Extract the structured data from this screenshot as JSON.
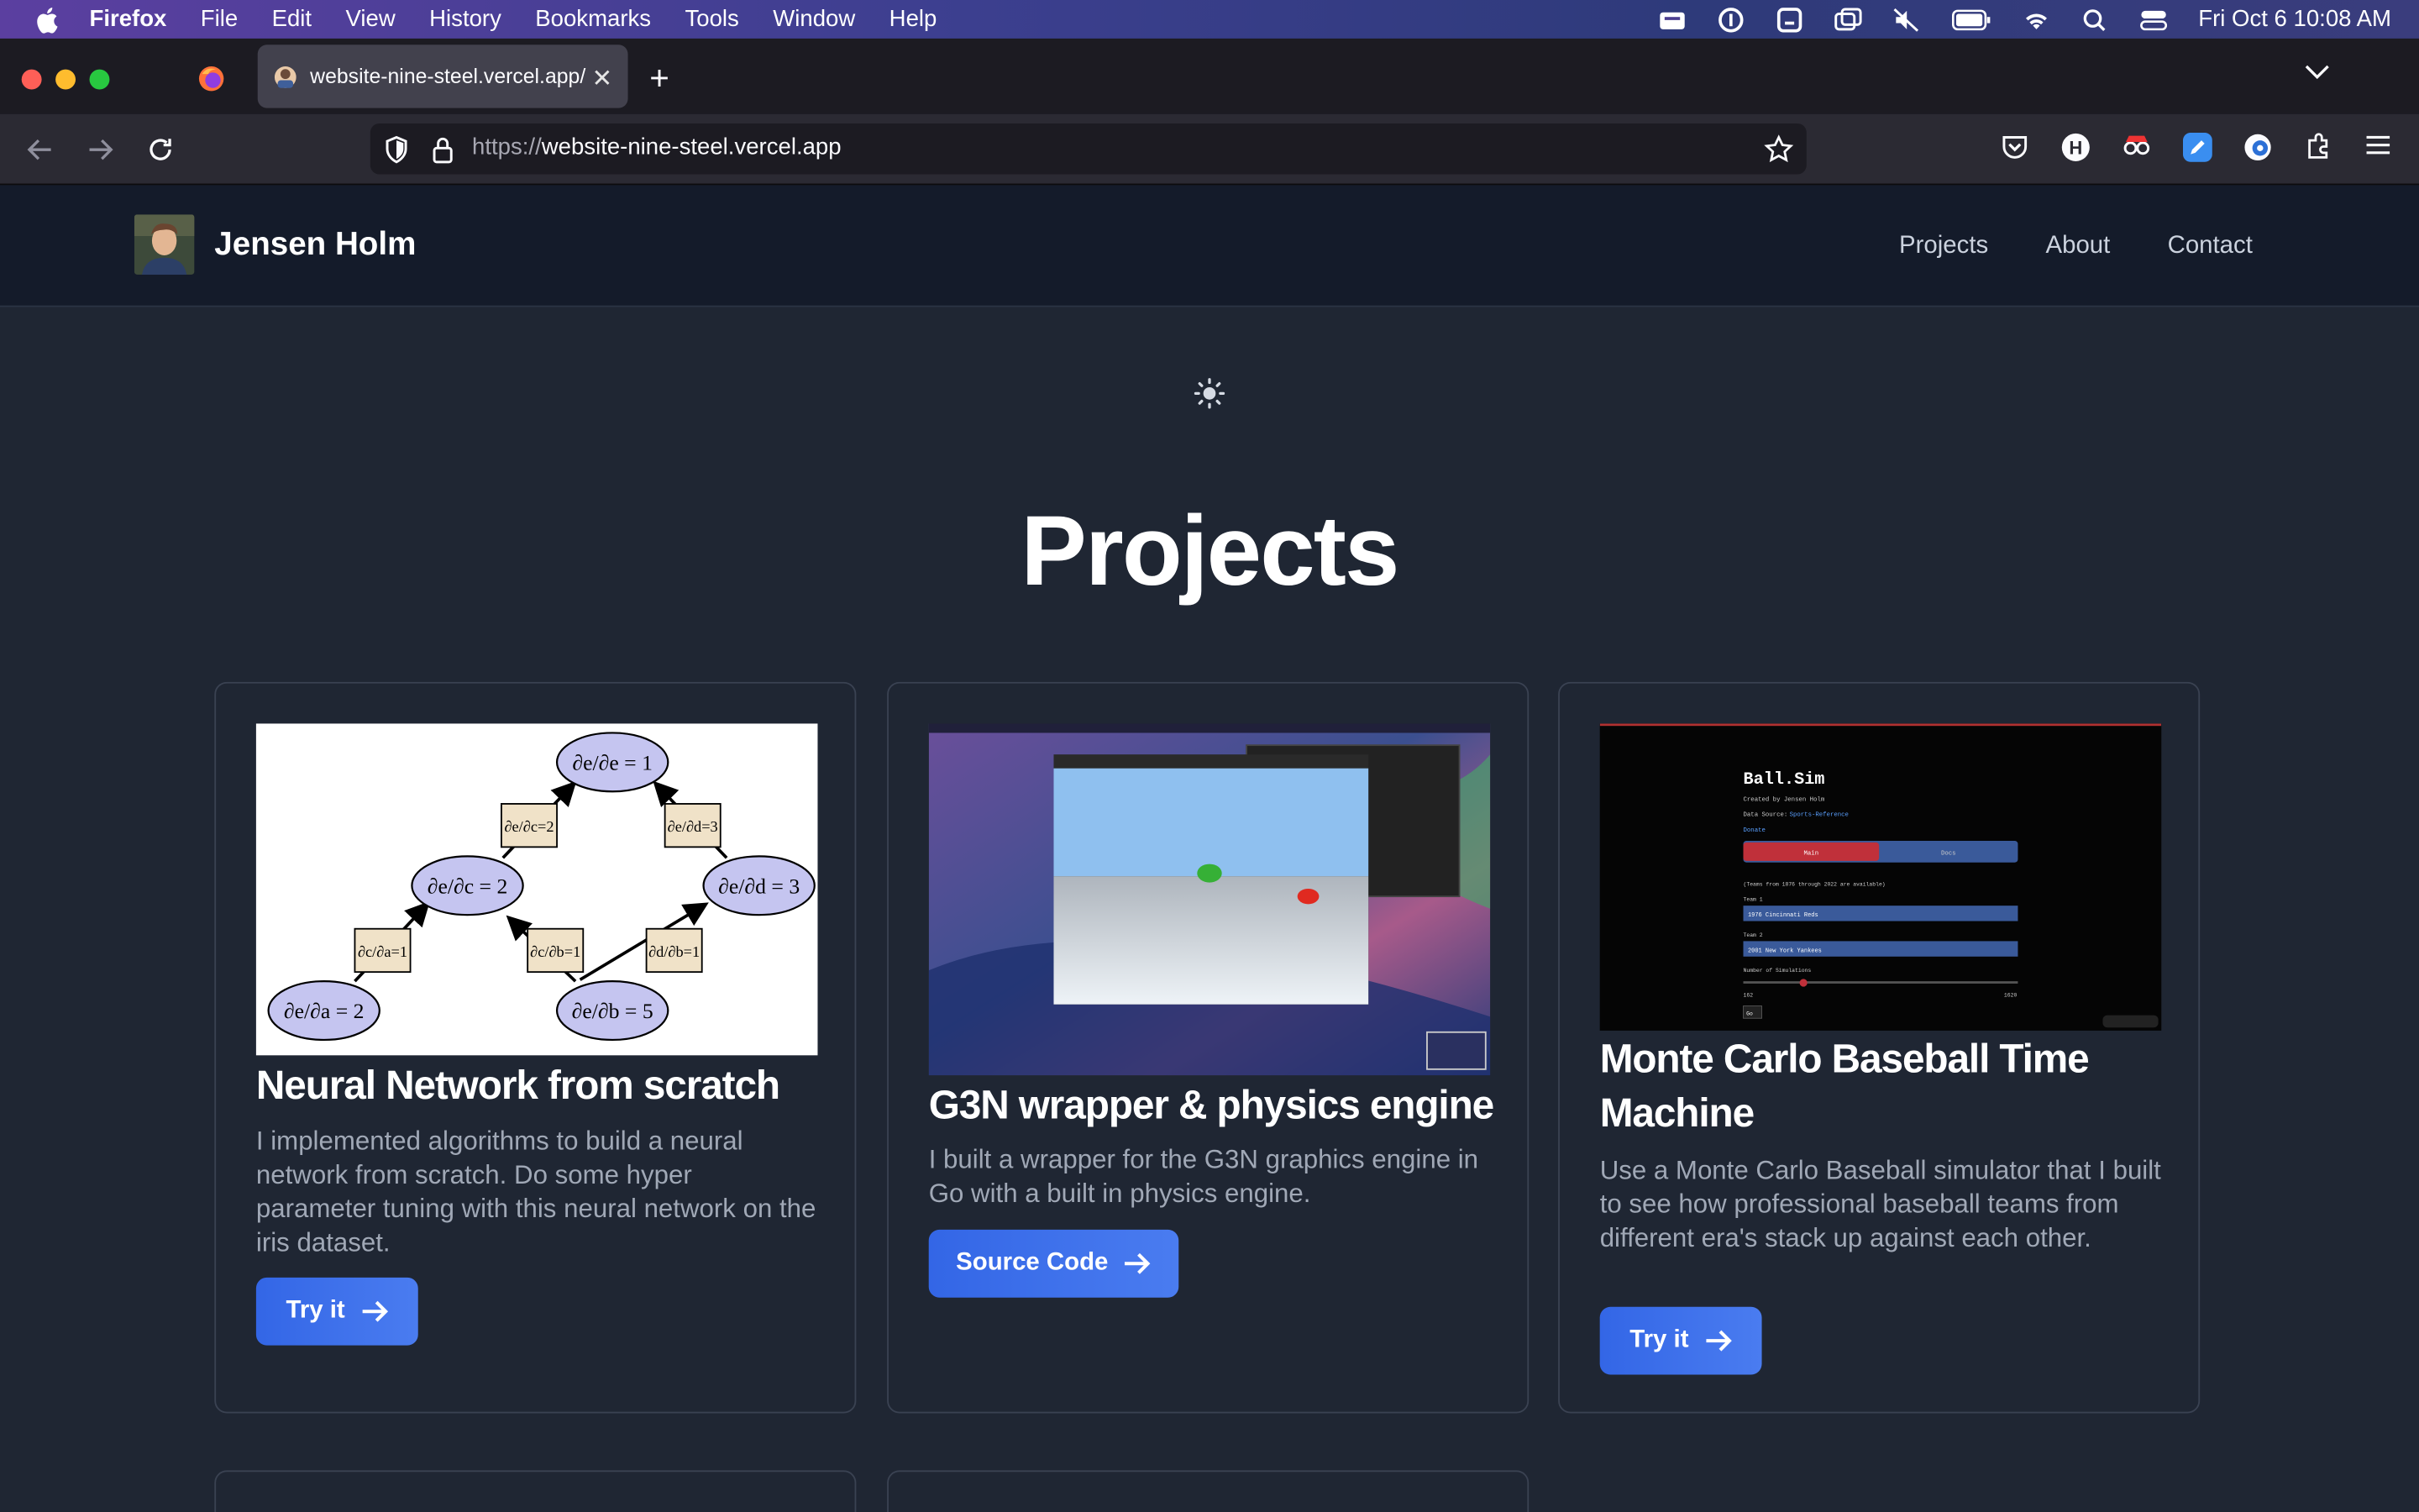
{
  "menubar": {
    "app": "Firefox",
    "menus": [
      "File",
      "Edit",
      "View",
      "History",
      "Bookmarks",
      "Tools",
      "Window",
      "Help"
    ],
    "clock": "Fri Oct 6  10:08 AM"
  },
  "browser": {
    "tab_title": "website-nine-steel.vercel.app/",
    "url_protocol": "https://",
    "url_host": "website-nine-steel.vercel.app"
  },
  "site": {
    "brand": "Jensen Holm",
    "nav": [
      "Projects",
      "About",
      "Contact"
    ],
    "page_title": "Projects"
  },
  "projects": [
    {
      "title": "Neural Network from scratch",
      "description": "I implemented algorithms to build a neural network from scratch. Do some hyper parameter tuning with this neural network on the iris dataset.",
      "button": "Try it"
    },
    {
      "title": "G3N wrapper & physics engine",
      "description": "I built a wrapper for the G3N graphics engine in Go with a built in physics engine.",
      "button": "Source Code"
    },
    {
      "title": "Monte Carlo Baseball Time Machine",
      "description": "Use a Monte Carlo Baseball simulator that I built to see how professional baseball teams from different era's stack up against each other.",
      "button": "Try it"
    }
  ],
  "thumb_ballsim": {
    "title": "Ball.Sim",
    "created": "Created by Jensen Holm",
    "source_label": "Data Source:",
    "source_link": "Sports-Reference",
    "donate": "Donate",
    "tab_main": "Main",
    "tab_docs": "Docs",
    "note": "(Teams from 1876 through 2022 are available)",
    "team1_label": "Team 1",
    "team1": "1976 Cincinnati Reds",
    "team2_label": "Team 2",
    "team2": "2001 New York Yankees",
    "sims_label": "Number of Simulations",
    "sims_min": "162",
    "sims_max": "1620",
    "go": "Go"
  },
  "colors": {
    "page_bg": "#1f2633",
    "header_bg": "#141b2a",
    "button_blue": "#3366e6"
  }
}
